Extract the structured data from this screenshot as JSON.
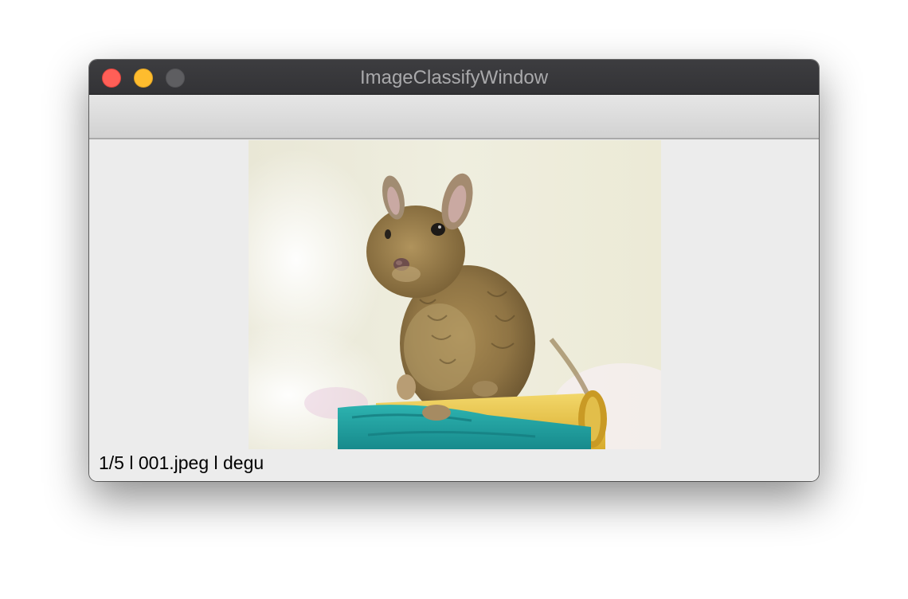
{
  "window": {
    "title": "ImageClassifyWindow"
  },
  "image": {
    "subject": "degu",
    "icon": "photo-of-degu"
  },
  "status_bar": {
    "text": "1/5 l 001.jpeg l degu"
  }
}
